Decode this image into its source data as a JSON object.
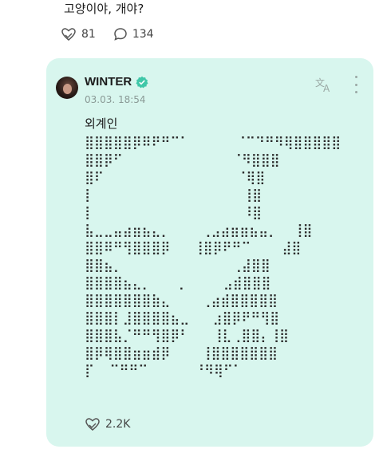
{
  "post": {
    "text": "고양이야, 개야?",
    "likes": "81",
    "comments": "134"
  },
  "quoted": {
    "author": "WINTER",
    "timestamp": "03.03. 18:54",
    "text": "외계인",
    "ascii_art": "⣿⣿⣿⣿⣿⡿⠿⠟⠛⠉⠁      ⠈⠉⠙⠛⠻⢿⣿⣿⣿⣿⣿\n⣿⣿⡿⠋              ⠈⠻⣿⣿⣿\n⣿⠏                 ⠈⢿⣿\n⡇                   ⢸⣿\n⡇                   ⠸⣿\n⣧⣀⣀⣤⣴⣶⣦⣄⡀    ⢀⣠⣴⣶⣶⣦⣤⡀  ⢸⣿\n⣿⣿⠿⠛⢻⣿⣿⣿⡿   ⢸⣿⡿⠟⠛⠉    ⣼⣿\n⣿⣿⣦⡀              ⢀⣼⣿⣿\n⣿⣿⣿⣿⣦⣄⡀   ⢀     ⣠⣾⣿⣿⣿\n⣿⣿⣿⣿⣿⣿⣿⣷⣄    ⢀⣴⣾⣿⣿⣿⣿⣿\n⣿⣿⣿⡇⣸⣿⣿⣿⣿⣦⣀   ⣰⣿⡿⠟⠛⢻⣿\n⣿⣿⣿⣧⡈⠛⠛⢻⣿⡿⠃   ⢸⣇⢀⣿⣿⡄⢸⣿\n⣿⡿⢿⣿⣿⣶⣶⣾⡿    ⢸⣿⣿⣿⣿⣿⣿⣿\n⡏  ⠉⠛⠛⠉      ⠘⠻⢿⠋⠁ ",
    "likes": "2.2K"
  },
  "colors": {
    "card_bg": "#d8f6ee",
    "verified": "#3fc7a8"
  },
  "icons": {
    "like": "heart-hand-icon",
    "comment": "speech-bubble-icon",
    "verified": "verified-badge-icon",
    "translate": "translate-icon",
    "more": "more-vertical-icon"
  }
}
